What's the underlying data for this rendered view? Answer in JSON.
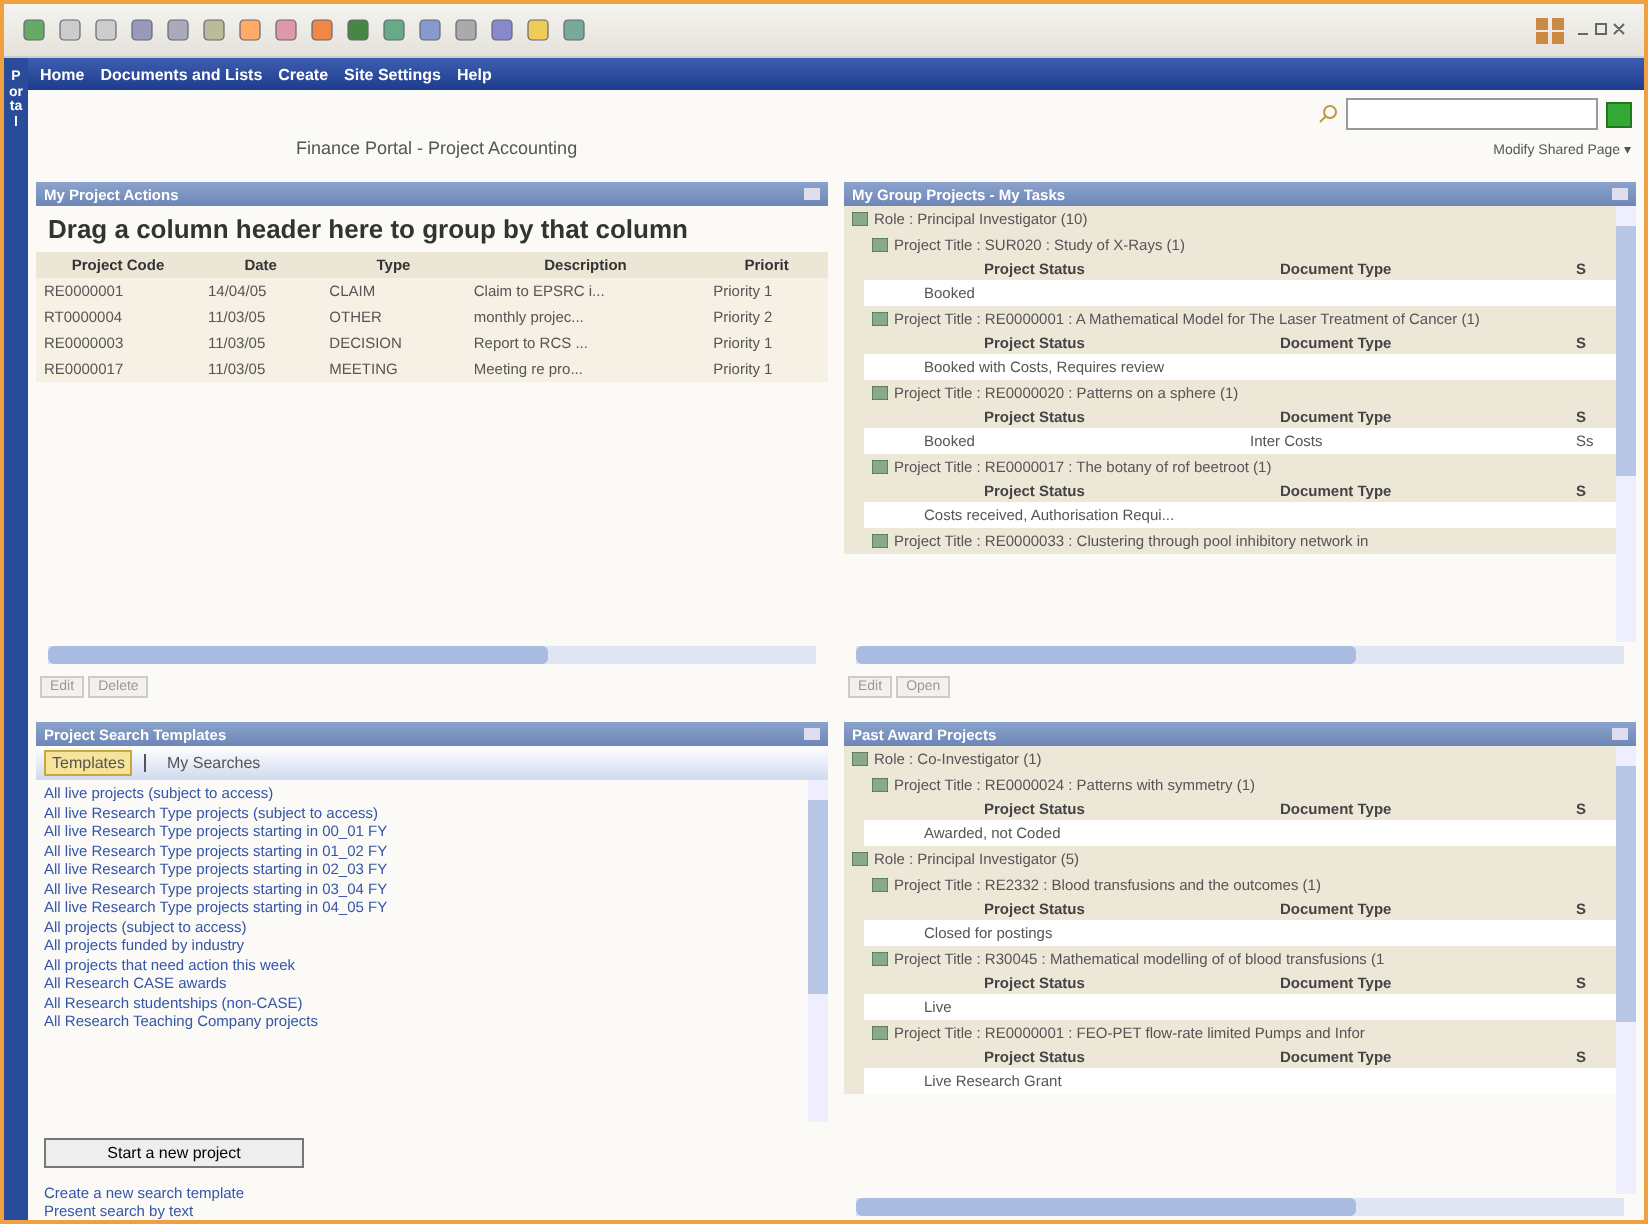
{
  "portal_tab": "Portal",
  "nav": [
    "Home",
    "Documents and Lists",
    "Create",
    "Site Settings",
    "Help"
  ],
  "page_title": "Finance Portal - Project Accounting",
  "modify_link": "Modify Shared Page ▾",
  "actions": {
    "title": "My Project Actions",
    "group_hint": "Drag a column header here to group by that column",
    "columns": [
      "Project Code",
      "Date",
      "Type",
      "Description",
      "Priorit"
    ],
    "rows": [
      [
        "RE0000001",
        "14/04/05",
        "CLAIM",
        "Claim to EPSRC i...",
        "Priority 1"
      ],
      [
        "RT0000004",
        "11/03/05",
        "OTHER",
        "monthly projec...",
        "Priority 2"
      ],
      [
        "RE0000003",
        "11/03/05",
        "DECISION",
        "Report to RCS ...",
        "Priority 1"
      ],
      [
        "RE0000017",
        "11/03/05",
        "MEETING",
        "Meeting re pro...",
        "Priority 1"
      ]
    ],
    "buttons": [
      "Edit",
      "Delete"
    ]
  },
  "tasks": {
    "title": "My Group Projects - My Tasks",
    "groups": [
      {
        "label": "Role : Principal Investigator (10)",
        "children": [
          {
            "label": "Project Title : SUR020 : Study of X-Rays (1)",
            "columns": [
              "Project Status",
              "Document Type",
              "S"
            ],
            "row": [
              "Booked"
            ]
          },
          {
            "label": "Project Title : RE0000001 : A Mathematical Model for The Laser Treatment of Cancer (1)",
            "columns": [
              "Project Status",
              "Document Type",
              "S"
            ],
            "row": [
              "Booked with Costs, Requires review"
            ]
          },
          {
            "label": "Project Title : RE0000020 : Patterns on a sphere (1)",
            "columns": [
              "Project Status",
              "Document Type",
              "S"
            ],
            "row": [
              "Booked",
              "Inter Costs",
              "Ss"
            ]
          },
          {
            "label": "Project Title : RE0000017 : The botany of rof beetroot (1)",
            "columns": [
              "Project Status",
              "Document Type",
              "S"
            ],
            "row": [
              "Costs received, Authorisation Requi..."
            ]
          },
          {
            "label": "Project Title : RE0000033 : Clustering through pool inhibitory network in"
          }
        ]
      }
    ],
    "buttons": [
      "Edit",
      "Open"
    ]
  },
  "templates": {
    "title": "Project Search Templates",
    "tabs": [
      {
        "label": "Templates",
        "selected": true
      },
      {
        "label": "My Searches",
        "selected": false
      }
    ],
    "links": [
      "All live projects (subject to access)",
      "All live Research Type projects (subject to access)",
      "All live Research Type projects starting in 00_01 FY",
      "All live Research Type projects starting in 01_02 FY",
      "All live Research Type projects starting in 02_03 FY",
      "All live Research Type projects starting in 03_04 FY",
      "All live Research Type projects starting in 04_05 FY",
      "All projects (subject to access)",
      "All projects funded by industry",
      "All projects that need action this week",
      "All Research CASE awards",
      "All Research studentships (non-CASE)",
      "All Research Teaching Company projects"
    ],
    "new_project_button": "Start a new project",
    "footer_links": [
      "Create a new search template",
      "Present search by text"
    ]
  },
  "past": {
    "title": "Past Award Projects",
    "groups": [
      {
        "label": "Role : Co-Investigator (1)",
        "children": [
          {
            "label": "Project Title : RE0000024 : Patterns with symmetry (1)",
            "columns": [
              "Project Status",
              "Document Type",
              "S"
            ],
            "row": [
              "Awarded, not Coded"
            ]
          }
        ]
      },
      {
        "label": "Role : Principal Investigator (5)",
        "children": [
          {
            "label": "Project Title : RE2332 : Blood transfusions and the outcomes (1)",
            "columns": [
              "Project Status",
              "Document Type",
              "S"
            ],
            "row": [
              "Closed for postings"
            ]
          },
          {
            "label": "Project Title : R30045 : Mathematical modelling of of blood transfusions (1",
            "columns": [
              "Project Status",
              "Document Type",
              "S"
            ],
            "row": [
              "Live"
            ]
          },
          {
            "label": "Project Title : RE0000001 : FEO-PET flow-rate limited Pumps and Infor",
            "columns": [
              "Project Status",
              "Document Type",
              "S"
            ],
            "row": [
              "Live Research Grant"
            ]
          }
        ]
      }
    ]
  }
}
